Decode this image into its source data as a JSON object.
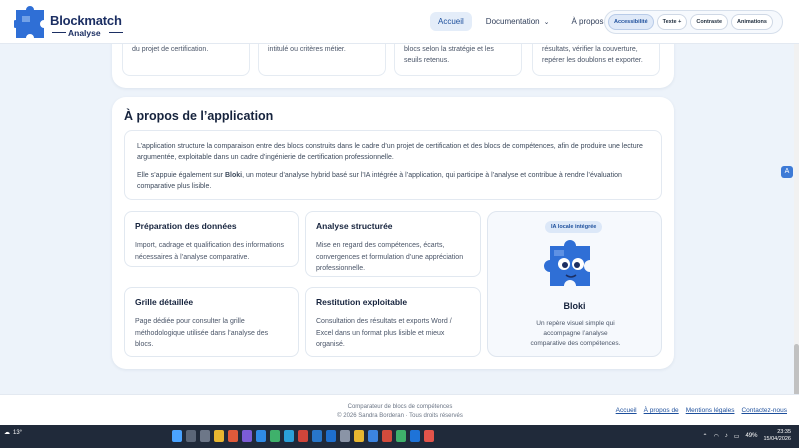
{
  "brand": {
    "name": "Blockmatch",
    "sub": "Analyse"
  },
  "nav": {
    "accueil": "Accueil",
    "documentation": "Documentation",
    "apropos": "À propos de"
  },
  "toolbar": {
    "accessibilite": "Accessibilité",
    "texte": "Texte +",
    "contraste": "Contraste",
    "animations": "Animations"
  },
  "top_cards": [
    {
      "text": "du projet de certification."
    },
    {
      "text": "intitulé ou critères métier."
    },
    {
      "text": "blocs selon la stratégie et les seuils retenus."
    },
    {
      "text": "résultats, vérifier la couverture, repérer les doublons et exporter."
    }
  ],
  "about": {
    "title": "À propos de l’application",
    "intro1": "L’application structure la comparaison entre des blocs construits dans le cadre d’un projet de certification et des blocs de compétences, afin de produire une lecture argumentée, exploitable dans un cadre d’ingénierie de certification professionnelle.",
    "intro2_pre": "Elle s’appuie également sur ",
    "intro2_bold": "Bloki",
    "intro2_post": ", un moteur d’analyse hybrid basé sur l’IA intégrée à l’application, qui participe à l’analyse et contribue à rendre l’évaluation comparative plus lisible.",
    "cards": [
      {
        "title": "Préparation des données",
        "text": "Import, cadrage et qualification des informations nécessaires à l’analyse comparative."
      },
      {
        "title": "Analyse structurée",
        "text": "Mise en regard des compétences, écarts, convergences et formulation d’une appréciation professionnelle."
      },
      {
        "title": "Grille détaillée",
        "text": "Page dédiée pour consulter la grille méthodologique utilisée dans l’analyse des blocs."
      },
      {
        "title": "Restitution exploitable",
        "text": "Consultation des résultats et exports Word / Excel dans un format plus lisible et mieux organisé."
      }
    ],
    "bloki": {
      "badge": "IA locale intégrée",
      "title": "Bloki",
      "desc": "Un repère visuel simple qui accompagne l’analyse comparative des compétences."
    }
  },
  "footer": {
    "line1": "Comparateur de blocs de compétences",
    "line2": "© 2026 Sandra Borderan · Tous droits réservés",
    "links": [
      "Accueil",
      "À propos de",
      "Mentions légales",
      "Contactez-nous"
    ]
  },
  "taskbar": {
    "temp": "13°",
    "battery": "49%",
    "time": "23:35",
    "date": "15/04/2026"
  },
  "colors": {
    "accent": "#1d4f9c",
    "puzzle": "#2f6fd6",
    "background": "#edf3fa"
  }
}
